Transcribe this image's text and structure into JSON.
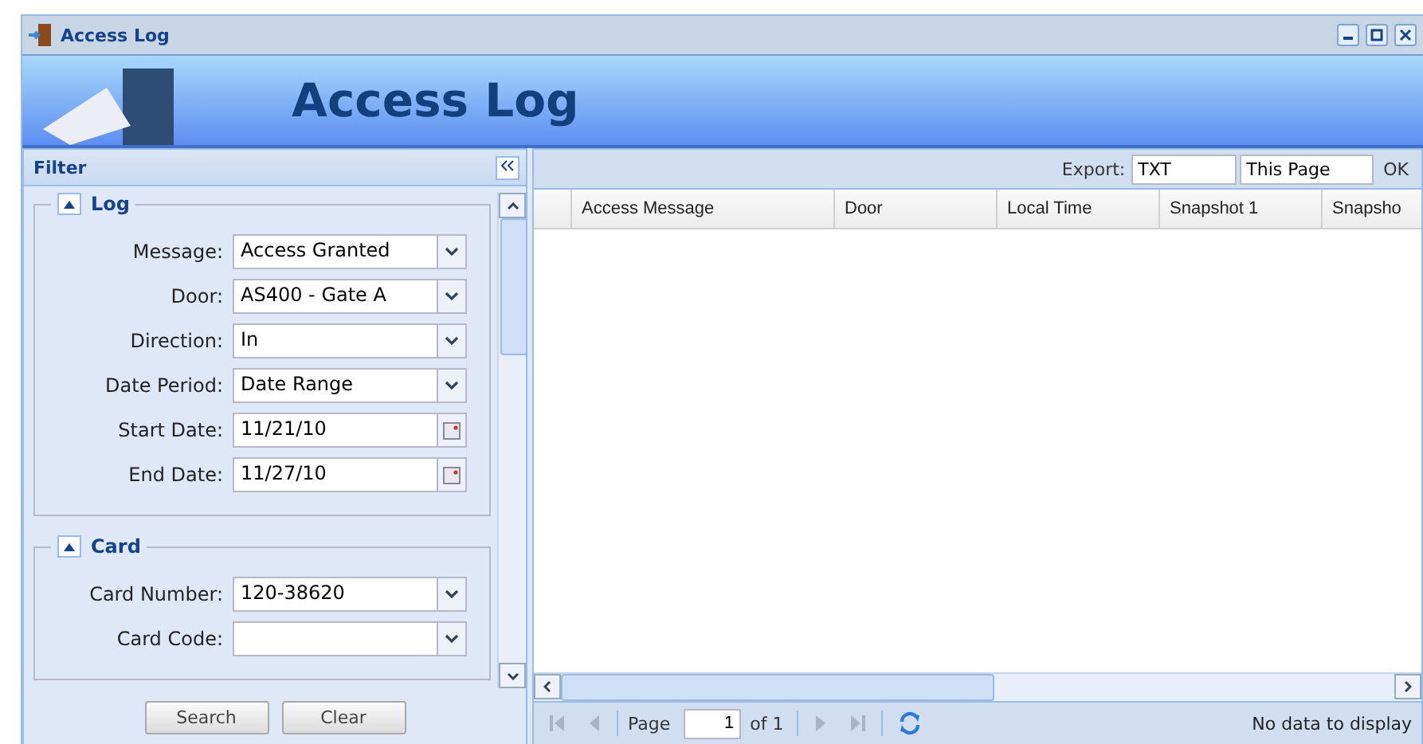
{
  "window": {
    "title": "Access Log"
  },
  "banner": {
    "title": "Access Log"
  },
  "filter": {
    "title": "Filter",
    "sections": [
      {
        "title": "Log",
        "expanded": true,
        "fields": [
          {
            "label": "Message:",
            "value": "Access Granted",
            "kind": "select"
          },
          {
            "label": "Door:",
            "value": "AS400 - Gate A",
            "kind": "select"
          },
          {
            "label": "Direction:",
            "value": "In",
            "kind": "select"
          },
          {
            "label": "Date Period:",
            "value": "Date Range",
            "kind": "select"
          },
          {
            "label": "Start Date:",
            "value": "11/21/10",
            "kind": "date"
          },
          {
            "label": "End Date:",
            "value": "11/27/10",
            "kind": "date"
          }
        ]
      },
      {
        "title": "Card",
        "expanded": true,
        "fields": [
          {
            "label": "Card Number:",
            "value": "120-38620",
            "kind": "select"
          },
          {
            "label": "Card Code:",
            "kind": "select"
          }
        ]
      }
    ],
    "buttons": [
      "Search",
      "Clear"
    ]
  },
  "export": {
    "label": "Export:",
    "format": "TXT",
    "scope": "This Page",
    "ok": "OK"
  },
  "table": {
    "columns": [
      "Access Message",
      "Door",
      "Local Time",
      "Snapshot 1",
      "Snapsho"
    ]
  },
  "pager": {
    "page_label": "Page",
    "page": "1",
    "of": "of 1",
    "status": "No data to display",
    "first_disabled": true,
    "prev_disabled": true,
    "next_disabled": true,
    "last_disabled": true
  }
}
